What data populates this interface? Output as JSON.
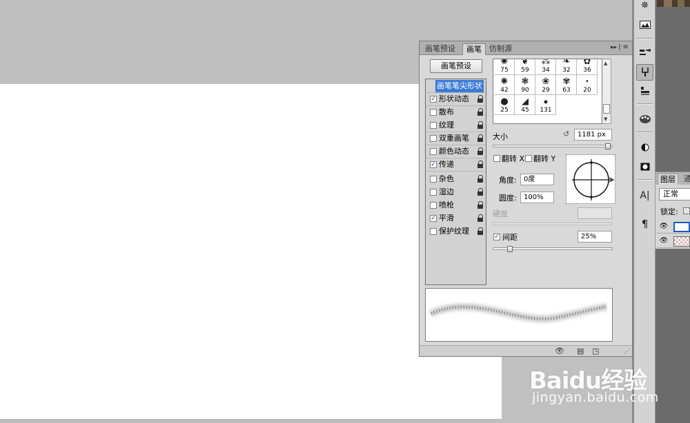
{
  "brush_panel": {
    "tabs": [
      "画笔预设",
      "画笔",
      "仿制源"
    ],
    "collapse_glyph": "▸▸",
    "menu_glyph": "|·≡",
    "presets_button": "画笔预设",
    "options": [
      {
        "label": "画笔笔尖形状",
        "checked": false,
        "selected": true
      },
      {
        "label": "形状动态",
        "checked": true
      },
      {
        "label": "散布",
        "checked": false
      },
      {
        "label": "纹理",
        "checked": false
      },
      {
        "label": "双重画笔",
        "checked": false
      },
      {
        "label": "颜色动态",
        "checked": false
      },
      {
        "label": "传递",
        "checked": true
      },
      {
        "label": "杂色",
        "checked": false
      },
      {
        "label": "湿边",
        "checked": false
      },
      {
        "label": "喷枪",
        "checked": false
      },
      {
        "label": "平滑",
        "checked": true
      },
      {
        "label": "保护纹理",
        "checked": false
      }
    ],
    "tip_sizes": [
      "75",
      "59",
      "34",
      "32",
      "36",
      "42",
      "90",
      "29",
      "63",
      "20",
      "25",
      "45",
      "131"
    ],
    "tip_glyphs": [
      "✺",
      "❦",
      "⁂",
      "❧",
      "✿",
      "✺",
      "❃",
      "❀",
      "✾",
      "•",
      "●",
      "◢",
      "◆"
    ],
    "size_label": "大小",
    "size_value": "1181 px",
    "size_fraction": 0.99,
    "flip_x_label": "翻转 X",
    "flip_y_label": "翻转 Y",
    "angle_label": "角度:",
    "angle_value": "0度",
    "roundness_label": "圆度:",
    "roundness_value": "100%",
    "hardness_label": "硬度",
    "spacing_label": "间距",
    "spacing_checked": true,
    "spacing_value": "25%",
    "spacing_fraction": 0.12
  },
  "layers_panel": {
    "tab_layers": "图层",
    "tab_channels": "通",
    "blend_mode": "正常",
    "lock_label": "锁定:"
  },
  "watermark": {
    "logo": "Baidu经验",
    "url": "jingyan.baidu.com"
  },
  "icons": {
    "dock": [
      "navigator-icon",
      "histogram-icon",
      "brush-presets-icon",
      "brush-icon",
      "clone-source-icon",
      "swatches-icon",
      "adjustments-icon",
      "masks-icon",
      "character-icon",
      "paragraph-icon"
    ]
  }
}
